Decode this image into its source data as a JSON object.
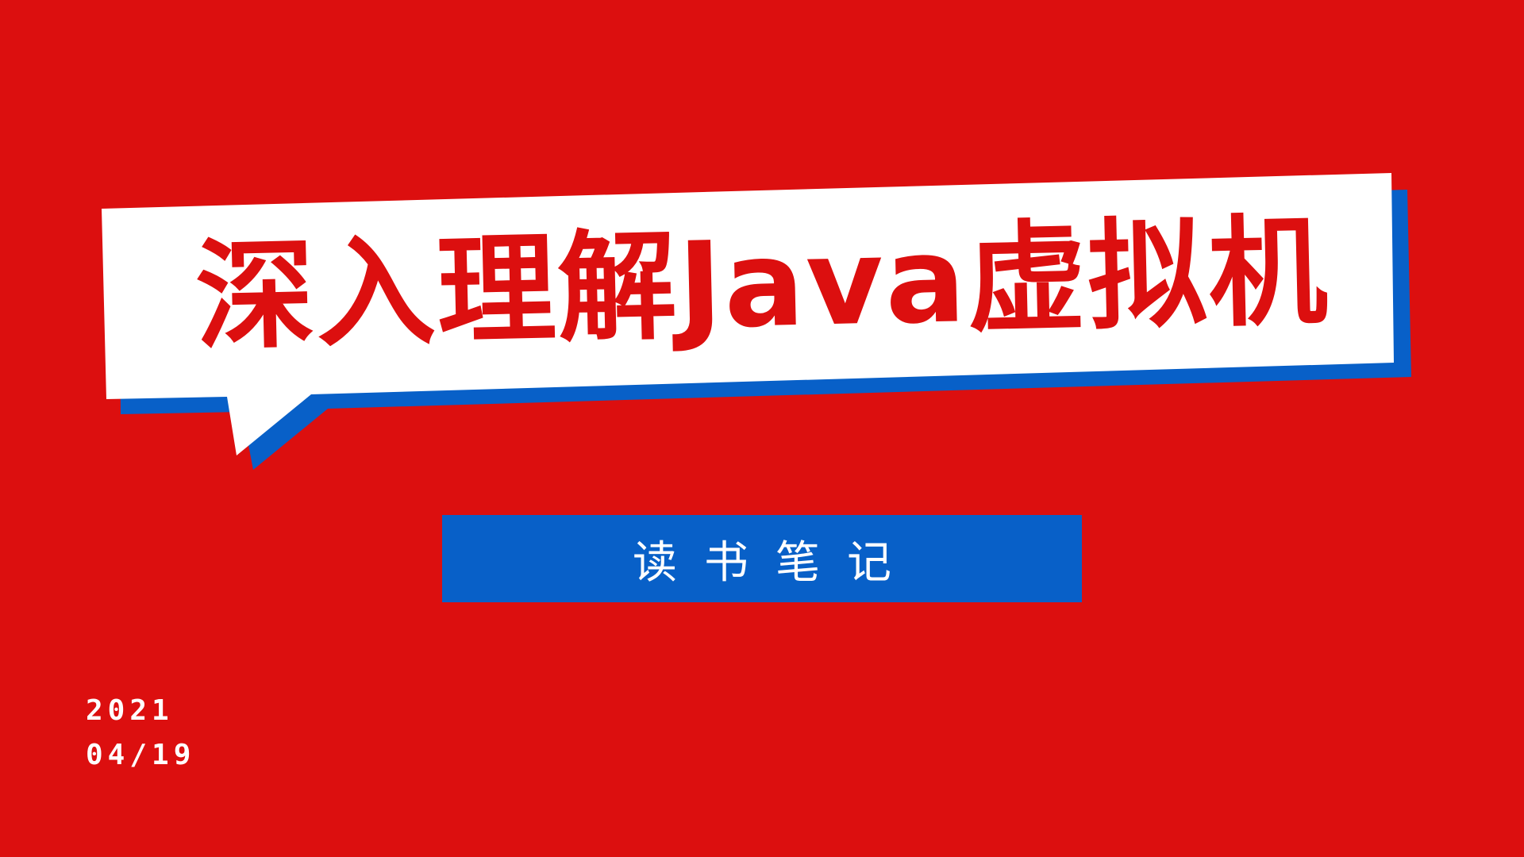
{
  "colors": {
    "background": "#dc0f0f",
    "bubble_fill": "#ffffff",
    "bubble_shadow": "#0860c8",
    "title_text": "#dc0f0f",
    "subtitle_box": "#0860c8",
    "subtitle_text": "#ffffff",
    "date_text": "#ffffff"
  },
  "title": "深入理解Java虚拟机",
  "subtitle": "读书笔记",
  "date": {
    "year": "2021",
    "month_day": "04/19"
  }
}
